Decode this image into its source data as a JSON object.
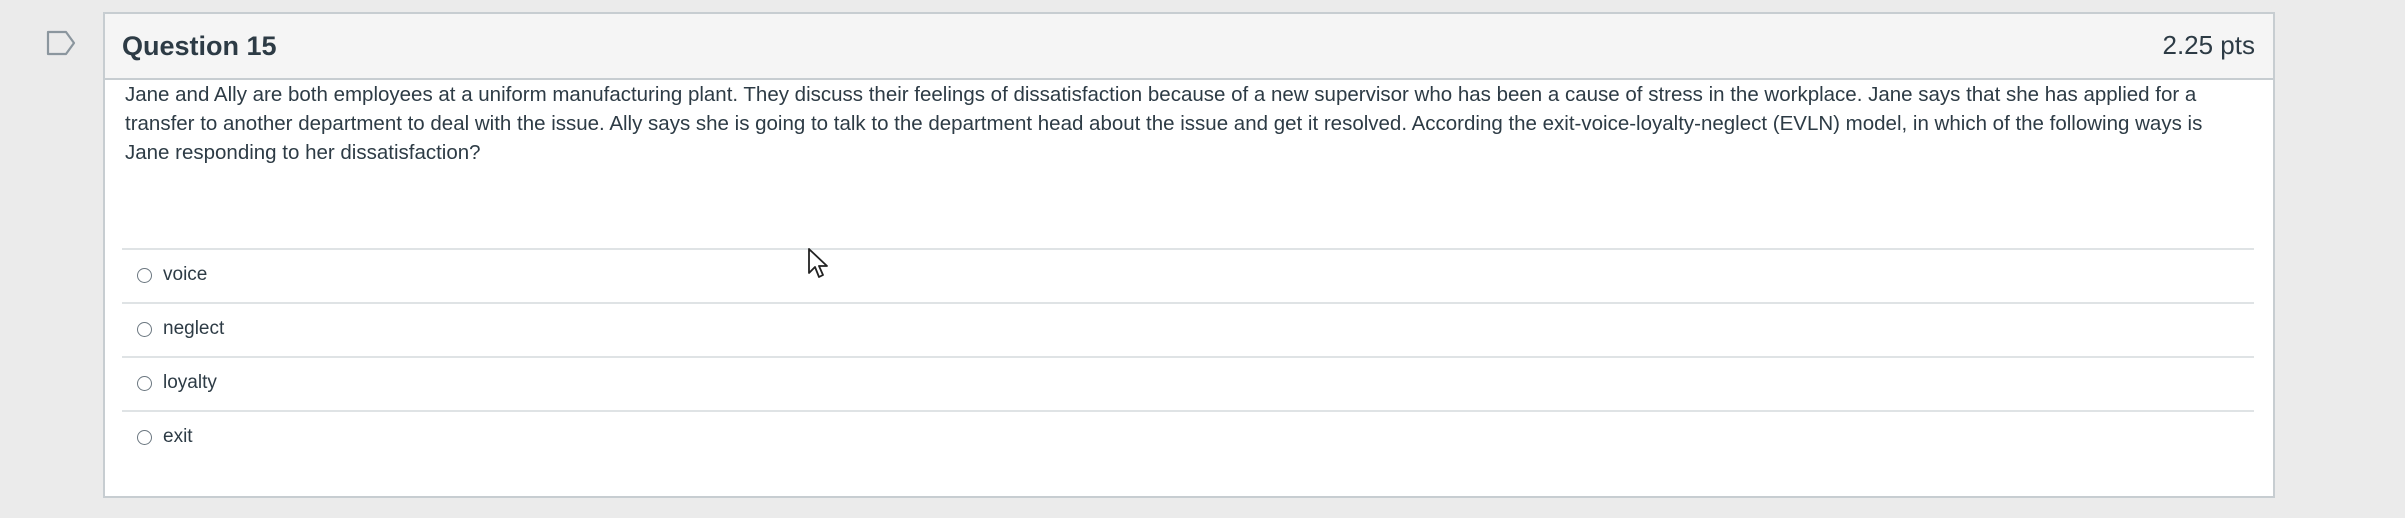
{
  "question": {
    "title": "Question 15",
    "points": "2.25 pts",
    "text": "Jane and Ally are both employees at a uniform manufacturing plant. They discuss their feelings of dissatisfaction because of a new supervisor who has been a cause of stress in the workplace. Jane says that she has applied for a transfer to another department to deal with the issue. Ally says she is going to talk to the department head about the issue and get it resolved. According the exit-voice-loyalty-neglect (EVLN) model, in which of the following ways is Jane responding to her dissatisfaction?",
    "answers": [
      {
        "label": "voice"
      },
      {
        "label": "neglect"
      },
      {
        "label": "loyalty"
      },
      {
        "label": "exit"
      }
    ]
  },
  "icons": {
    "flag": "flag-icon",
    "radio": "radio-button-icon",
    "cursor": "mouse-pointer-icon"
  },
  "colors": {
    "background": "#ebebeb",
    "border": "#c7cdd1",
    "header_bg": "#f5f5f5",
    "text": "#2d3b45",
    "divider": "#dfe3e5"
  }
}
